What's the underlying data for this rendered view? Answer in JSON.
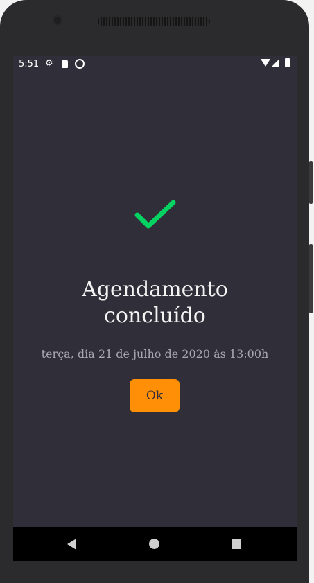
{
  "status_bar": {
    "time": "5:51",
    "icons": [
      "settings-icon",
      "sd-card-icon",
      "sync-icon",
      "wifi-icon",
      "cell-signal-icon",
      "battery-icon"
    ]
  },
  "main": {
    "icon": "check-icon",
    "title_line1": "Agendamento",
    "title_line2": "concluído",
    "subtitle": "terça, dia 21 de julho de 2020 às 13:00h",
    "ok_label": "Ok"
  },
  "nav_bar": {
    "icons": [
      "back-icon",
      "home-icon",
      "recents-icon"
    ]
  },
  "colors": {
    "background": "#302e38",
    "accent": "#ff8f06",
    "check": "#04d361",
    "text": "#f3f3f3",
    "subtitle": "#a9a8b1"
  }
}
